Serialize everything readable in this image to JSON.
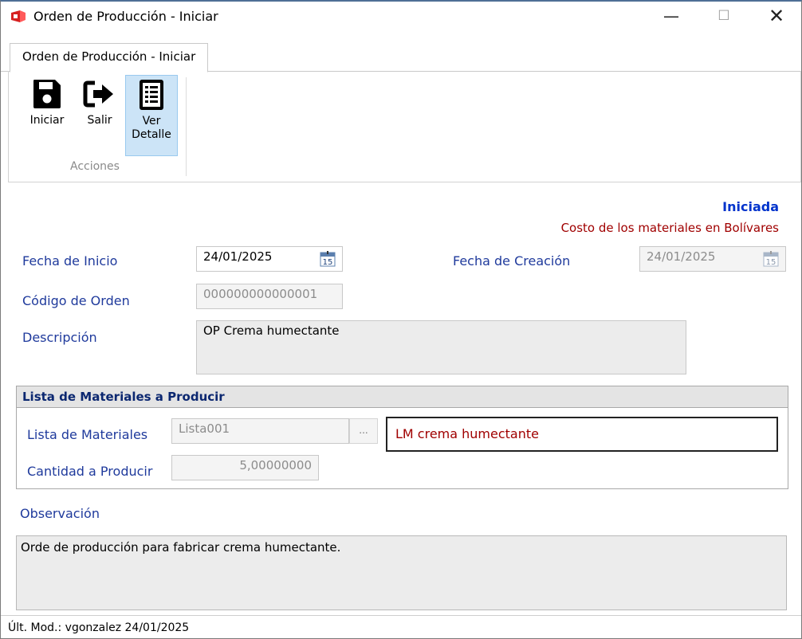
{
  "window": {
    "title": "Orden de Producción - Iniciar",
    "minimize_glyph": "—",
    "maximize_glyph": "☐",
    "close_glyph": "✕"
  },
  "ribbon": {
    "tab_label": "Orden de Producción - Iniciar",
    "group_label": "Acciones",
    "buttons": {
      "iniciar": "Iniciar",
      "salir": "Salir",
      "ver_detalle_line1": "Ver",
      "ver_detalle_line2": "Detalle"
    }
  },
  "header": {
    "status": "Iniciada",
    "currency_note": "Costo de los materiales en Bolívares"
  },
  "form": {
    "fecha_inicio_label": "Fecha de Inicio",
    "fecha_inicio_value": "24/01/2025",
    "fecha_creacion_label": "Fecha de Creación",
    "fecha_creacion_value": "24/01/2025",
    "calendar_day": "15",
    "codigo_label": "Código de Orden",
    "codigo_value": "000000000000001",
    "descripcion_label": "Descripción",
    "descripcion_value": "OP Crema humectante"
  },
  "materials": {
    "section_title": "Lista de Materiales a Producir",
    "lista_label": "Lista de Materiales",
    "lista_code": "Lista001",
    "lookup_button": "...",
    "lista_description": "LM crema humectante",
    "cantidad_label": "Cantidad a Producir",
    "cantidad_value": "5,00000000"
  },
  "observation": {
    "label": "Observación",
    "value": "Orde de producción para fabricar crema humectante."
  },
  "footer": {
    "last_modified": "Últ. Mod.:  vgonzalez  24/01/2025"
  },
  "colors": {
    "label_blue": "#1f3a9c",
    "status_blue": "#0033cc",
    "accent_red": "#a00000",
    "selected_button_bg": "#cce4f7"
  }
}
